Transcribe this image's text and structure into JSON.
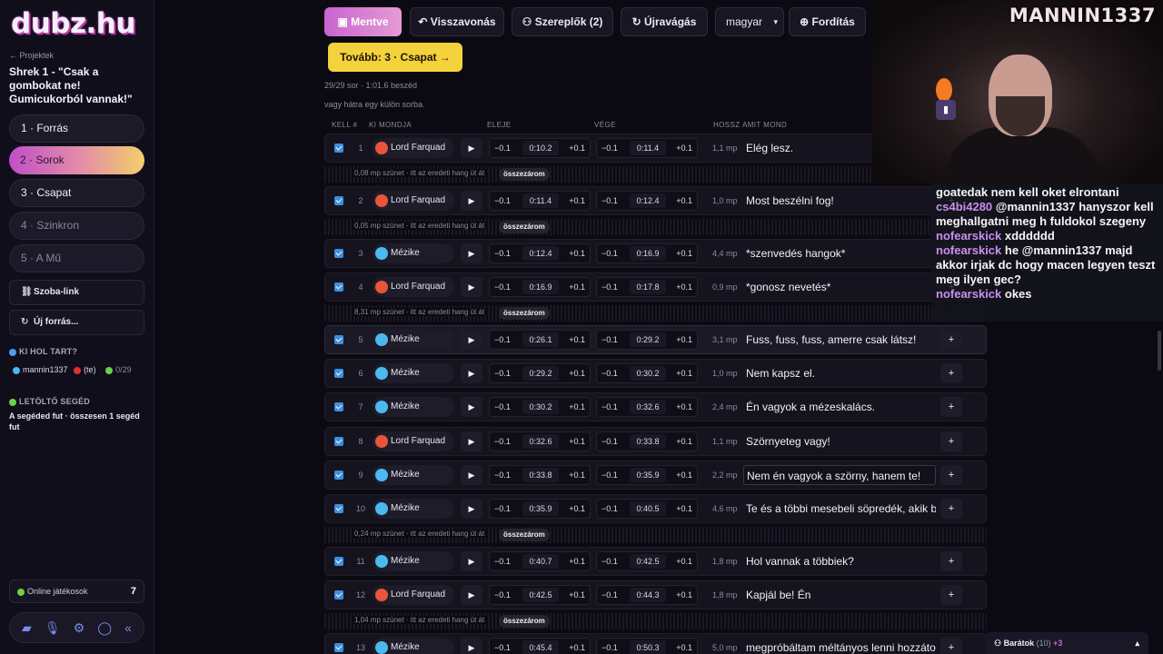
{
  "sidebar": {
    "logo": "dubz.hu",
    "back_link": "← Projektek",
    "project_title": "Shrek 1 - \"Csak a gombokat ne! Gumicukorból vannak!\"",
    "steps": [
      "1 · Forrás",
      "2 · Sorok",
      "3 · Csapat",
      "4 · Szinkron",
      "5 · A Mű"
    ],
    "room_link": "Szoba-link",
    "new_source": "Új forrás...",
    "who_head": "KI HOL TART?",
    "user": {
      "name": "mannin1337",
      "you": "(te)",
      "progress": "0/29"
    },
    "helper_head": "LETÖLTŐ SEGÉD",
    "helper_text": "A segéded fut · összesen 1 segéd fut",
    "online_label": "Online játékosok",
    "online_count": "7",
    "bottom_icons": [
      "folder-icon",
      "microphone-icon",
      "gear-icon",
      "chat-icon",
      "collapse-icon"
    ]
  },
  "toolbar": {
    "saved": "Mentve",
    "undo": "Visszavonás",
    "actors": "Szereplők (2)",
    "replay": "Újravágás",
    "language": "magyar",
    "translate": "Fordítás",
    "next": "Tovább: 3 · Csapat →"
  },
  "meta": {
    "summary": "29/29 sor · 1:01.6 beszéd",
    "hint": "vagy hátra egy külön sorba."
  },
  "columns": {
    "kell": "KELL #",
    "who": "KI MONDJA",
    "start": "ELEJE",
    "end": "VÉGE",
    "length": "HOSSZ",
    "what": "AMIT MOND"
  },
  "time_controls": {
    "minus": "−0.1",
    "plus": "+0.1",
    "add": "+"
  },
  "gap_button": "összezárom",
  "gaps": [
    "0,08 mp szünet · itt az eredeti hang üt át",
    "0,05 mp szünet · itt az eredeti hang üt át",
    "8,31 mp szünet · itt az eredeti hang üt át",
    "0,24 mp szünet · itt az eredeti hang üt át",
    "1,04 mp szünet · itt az eredeti hang üt át"
  ],
  "rows": [
    {
      "n": "1",
      "speaker": "Lord Farquad",
      "start": "0:10.2",
      "end": "0:11.4",
      "dur": "1,1 mp",
      "text": "Elég lesz."
    },
    {
      "n": "2",
      "speaker": "Lord Farquad",
      "start": "0:11.4",
      "end": "0:12.4",
      "dur": "1,0 mp",
      "text": "Most beszélni fog!"
    },
    {
      "n": "3",
      "speaker": "Mézike",
      "start": "0:12.4",
      "end": "0:16.9",
      "dur": "4,4 mp",
      "text": "*szenvedés hangok*"
    },
    {
      "n": "4",
      "speaker": "Lord Farquad",
      "start": "0:16.9",
      "end": "0:17.8",
      "dur": "0,9 mp",
      "text": "*gonosz nevetés*"
    },
    {
      "n": "5",
      "speaker": "Mézike",
      "start": "0:26.1",
      "end": "0:29.2",
      "dur": "3,1 mp",
      "text": "Fuss, fuss, fuss, amerre csak látsz!"
    },
    {
      "n": "6",
      "speaker": "Mézike",
      "start": "0:29.2",
      "end": "0:30.2",
      "dur": "1,0 mp",
      "text": "Nem kapsz el."
    },
    {
      "n": "7",
      "speaker": "Mézike",
      "start": "0:30.2",
      "end": "0:32.6",
      "dur": "2,4 mp",
      "text": "Én vagyok a mézeskalács."
    },
    {
      "n": "8",
      "speaker": "Lord Farquad",
      "start": "0:32.6",
      "end": "0:33.8",
      "dur": "1,1 mp",
      "text": "Szörnyeteg vagy!"
    },
    {
      "n": "9",
      "speaker": "Mézike",
      "start": "0:33.8",
      "end": "0:35.9",
      "dur": "2,2 mp",
      "text": "Nem én vagyok a szörny, hanem te!"
    },
    {
      "n": "10",
      "speaker": "Mézike",
      "start": "0:35.9",
      "end": "0:40.5",
      "dur": "4,6 mp",
      "text": "Te és a többi mesebeli söpredék, akik be"
    },
    {
      "n": "11",
      "speaker": "Mézike",
      "start": "0:40.7",
      "end": "0:42.5",
      "dur": "1,8 mp",
      "text": "Hol vannak a többiek?"
    },
    {
      "n": "12",
      "speaker": "Lord Farquad",
      "start": "0:42.5",
      "end": "0:44.3",
      "dur": "1,8 mp",
      "text": "Kapjál be! Én"
    },
    {
      "n": "13",
      "speaker": "Mézike",
      "start": "0:45.4",
      "end": "0:50.3",
      "dur": "5,0 mp",
      "text": "megpróbáltam méltányos lenni hozzáto"
    }
  ],
  "colors": {
    "farquad": "#e8553a",
    "mezike": "#4cb8f0",
    "accent": "#c864d0",
    "next": "#f3d23c"
  },
  "stream": {
    "name": "MANNIN1337",
    "chat": [
      {
        "user": "",
        "msg": "goatedak nem kell oket elrontani"
      },
      {
        "user": "cs4bi4280",
        "msg": "@mannin1337 hanyszor kell meghallgatni meg h fuldokol szegeny"
      },
      {
        "user": "nofearskick",
        "msg": "xdddddd"
      },
      {
        "user": "nofearskick",
        "msg": "he @mannin1337 majd akkor irjak dc hogy macen legyen teszt meg ilyen gec?"
      },
      {
        "user": "nofearskick",
        "msg": "okes"
      }
    ]
  },
  "friends": {
    "label": "Barátok",
    "count": "(10)",
    "plus": "+3"
  }
}
